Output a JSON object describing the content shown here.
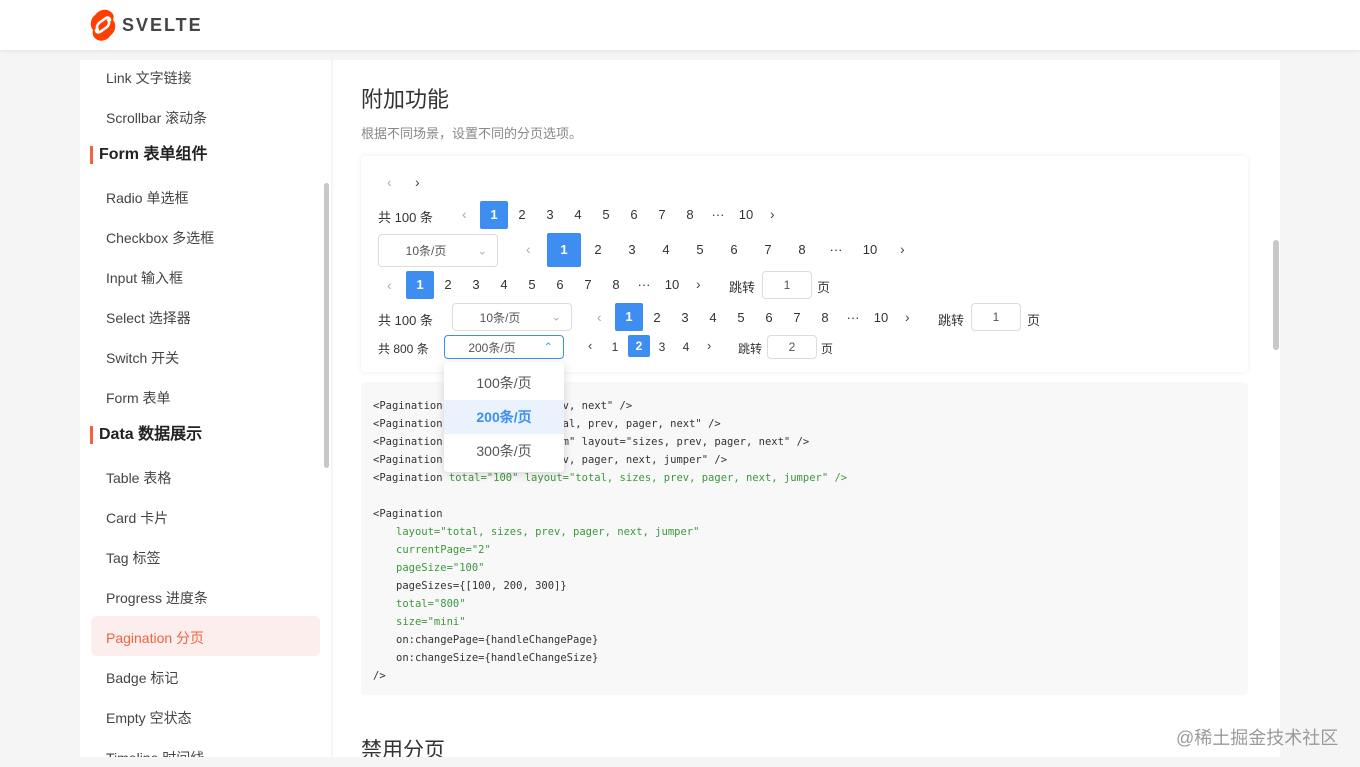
{
  "brand": {
    "name": "SVELTE",
    "color": "#ff3e00"
  },
  "sidebar": {
    "items": [
      {
        "label": "Link 文字链接",
        "kind": "item"
      },
      {
        "label": "Scrollbar 滚动条",
        "kind": "item"
      },
      {
        "label": "Form 表单组件",
        "kind": "group"
      },
      {
        "label": "Radio 单选框",
        "kind": "item"
      },
      {
        "label": "Checkbox 多选框",
        "kind": "item"
      },
      {
        "label": "Input 输入框",
        "kind": "item"
      },
      {
        "label": "Select 选择器",
        "kind": "item"
      },
      {
        "label": "Switch 开关",
        "kind": "item"
      },
      {
        "label": "Form 表单",
        "kind": "item"
      },
      {
        "label": "Data 数据展示",
        "kind": "group"
      },
      {
        "label": "Table 表格",
        "kind": "item"
      },
      {
        "label": "Card 卡片",
        "kind": "item"
      },
      {
        "label": "Tag 标签",
        "kind": "item"
      },
      {
        "label": "Progress 进度条",
        "kind": "item"
      },
      {
        "label": "Pagination 分页",
        "kind": "item",
        "active": true
      },
      {
        "label": "Badge 标记",
        "kind": "item"
      },
      {
        "label": "Empty 空状态",
        "kind": "item"
      },
      {
        "label": "Timeline 时间线",
        "kind": "item"
      }
    ],
    "active_color": "#f0633d",
    "active_bg": "#fdeeee"
  },
  "section": {
    "title": "附加功能",
    "description": "根据不同场景，设置不同的分页选项。",
    "next_title": "禁用分页"
  },
  "demo": {
    "total_100": "共 100 条",
    "total_800": "共 800 条",
    "ellipsis": "···",
    "jump": "跳转",
    "page_unit": "页",
    "size_10": "10条/页",
    "size_200": "200条/页",
    "jump_value_1": "1",
    "jump_value_2": "2",
    "pages_full": [
      "1",
      "2",
      "3",
      "4",
      "5",
      "6",
      "7",
      "8",
      "10"
    ],
    "pages_mini": [
      "1",
      "2",
      "3",
      "4"
    ],
    "active_color": "#3d8ef0"
  },
  "dropdown": {
    "options": [
      "100条/页",
      "200条/页",
      "300条/页"
    ],
    "selected": "200条/页"
  },
  "code": {
    "lines": [
      {
        "tag": "<Pagination",
        "rest": "prev, next\" />"
      },
      {
        "tag": "<Pagination",
        "rest": "total, prev, pager, next\" />"
      },
      {
        "tag": "<Pagination",
        "rest": "dium\" layout=\"sizes, prev, pager, next\" />"
      },
      {
        "tag": "<Pagination",
        "rest": "prev, pager, next, jumper\" />"
      },
      {
        "tag": "<Pagination",
        "rest": "total=\"100\" layout=\"total, sizes, prev, pager, next, jumper\" />"
      }
    ],
    "block_open": "<Pagination",
    "block_props": [
      {
        "text": "layout=\"total, sizes, prev, pager, next, jumper\"",
        "green": true
      },
      {
        "text": "currentPage=\"2\"",
        "green": true
      },
      {
        "text": "pageSize=\"100\"",
        "green": true
      },
      {
        "text": "pageSizes={[100, 200, 300]}",
        "green": false
      },
      {
        "text": "total=\"800\"",
        "green": true
      },
      {
        "text": "size=\"mini\"",
        "green": true
      },
      {
        "text": "on:changePage={handleChangePage}",
        "green": false
      },
      {
        "text": "on:changeSize={handleChangeSize}",
        "green": false
      }
    ],
    "block_close": "/>"
  },
  "watermark": "@稀土掘金技术社区"
}
